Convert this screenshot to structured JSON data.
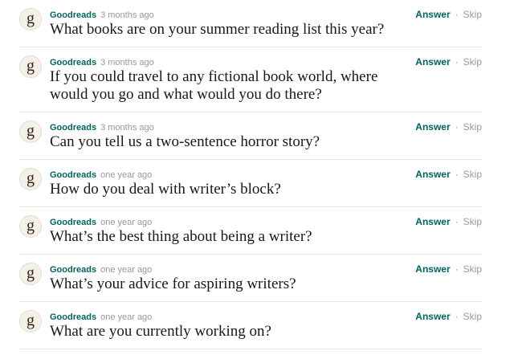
{
  "questions": [
    {
      "avatar_letter": "g",
      "author": "Goodreads",
      "time": "3 months ago",
      "question": "What books are on your summer reading list this year?",
      "answer_label": "Answer",
      "separator": "·",
      "skip_label": "Skip"
    },
    {
      "avatar_letter": "g",
      "author": "Goodreads",
      "time": "3 months ago",
      "question": "If you could travel to any fictional book world, where would you go and what would you do there?",
      "answer_label": "Answer",
      "separator": "·",
      "skip_label": "Skip"
    },
    {
      "avatar_letter": "g",
      "author": "Goodreads",
      "time": "3 months ago",
      "question": "Can you tell us a two-sentence horror story?",
      "answer_label": "Answer",
      "separator": "·",
      "skip_label": "Skip"
    },
    {
      "avatar_letter": "g",
      "author": "Goodreads",
      "time": "one year ago",
      "question": "How do you deal with writer’s block?",
      "answer_label": "Answer",
      "separator": "·",
      "skip_label": "Skip"
    },
    {
      "avatar_letter": "g",
      "author": "Goodreads",
      "time": "one year ago",
      "question": "What’s the best thing about being a writer?",
      "answer_label": "Answer",
      "separator": "·",
      "skip_label": "Skip"
    },
    {
      "avatar_letter": "g",
      "author": "Goodreads",
      "time": "one year ago",
      "question": "What’s your advice for aspiring writers?",
      "answer_label": "Answer",
      "separator": "·",
      "skip_label": "Skip"
    },
    {
      "avatar_letter": "g",
      "author": "Goodreads",
      "time": "one year ago",
      "question": "What are you currently working on?",
      "answer_label": "Answer",
      "separator": "·",
      "skip_label": "Skip"
    }
  ],
  "colors": {
    "brand_green": "#00635d",
    "muted_gray": "#999999",
    "text_dark": "#181818",
    "avatar_brown": "#382110"
  },
  "icons": {
    "avatar": "goodreads-g-icon"
  }
}
